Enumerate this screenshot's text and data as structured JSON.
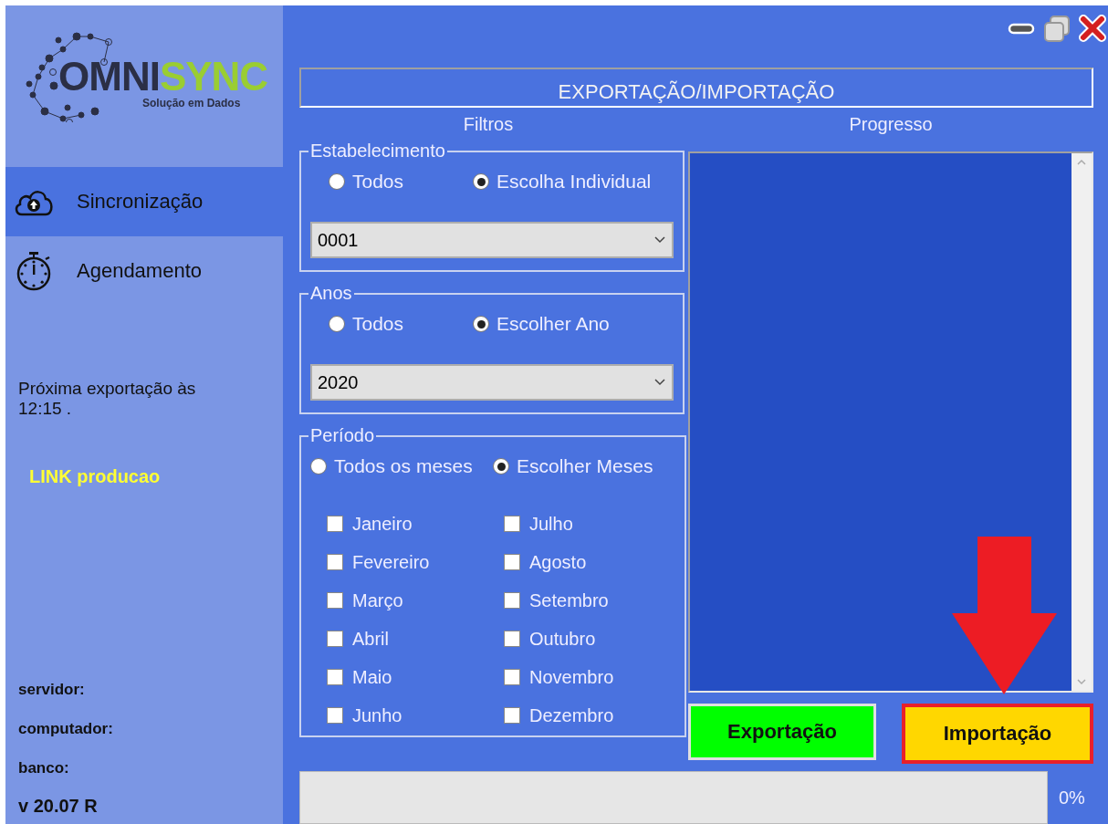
{
  "logo": {
    "name_left": "OMNI",
    "name_right": "SYNC",
    "tagline": "Solução em Dados"
  },
  "nav": [
    {
      "label": "Sincronização",
      "kind": "cloud",
      "selected": true
    },
    {
      "label": "Agendamento",
      "kind": "stopwatch",
      "selected": false
    }
  ],
  "next_export": "Próxima exportação às 12:15 .",
  "link": "LINK producao",
  "info": [
    "servidor:",
    "computador:",
    "banco:"
  ],
  "version": "v 20.07 R",
  "title": "EXPORTAÇÃO/IMPORTAÇÃO",
  "filters": {
    "heading": "Filtros",
    "groups": [
      {
        "title": "Estabelecimento",
        "options": [
          {
            "label": "Todos",
            "selected": false
          },
          {
            "label": "Escolha Individual",
            "selected": true
          }
        ],
        "select": {
          "value": "0001"
        }
      },
      {
        "title": "Anos",
        "options": [
          {
            "label": "Todos",
            "selected": false
          },
          {
            "label": "Escolher Ano",
            "selected": true
          }
        ],
        "select": {
          "value": "2020"
        }
      },
      {
        "title": "Período",
        "options": [
          {
            "label": "Todos os meses",
            "selected": false
          },
          {
            "label": "Escolher Meses",
            "selected": true
          }
        ],
        "months": [
          {
            "label": "Janeiro",
            "checked": false
          },
          {
            "label": "Fevereiro",
            "checked": false
          },
          {
            "label": "Março",
            "checked": false
          },
          {
            "label": "Abril",
            "checked": false
          },
          {
            "label": "Maio",
            "checked": false
          },
          {
            "label": "Junho",
            "checked": false
          },
          {
            "label": "Julho",
            "checked": false
          },
          {
            "label": "Agosto",
            "checked": false
          },
          {
            "label": "Setembro",
            "checked": false
          },
          {
            "label": "Outubro",
            "checked": false
          },
          {
            "label": "Novembro",
            "checked": false
          },
          {
            "label": "Dezembro",
            "checked": false
          }
        ]
      }
    ]
  },
  "progress": {
    "heading": "Progresso"
  },
  "buttons": [
    {
      "label": "Exportação",
      "color": "#00ff00",
      "highlighted": false
    },
    {
      "label": "Importação",
      "color": "#ffd700",
      "highlighted": true
    }
  ],
  "progress_bar": {
    "level": 0,
    "reading": "0%"
  }
}
